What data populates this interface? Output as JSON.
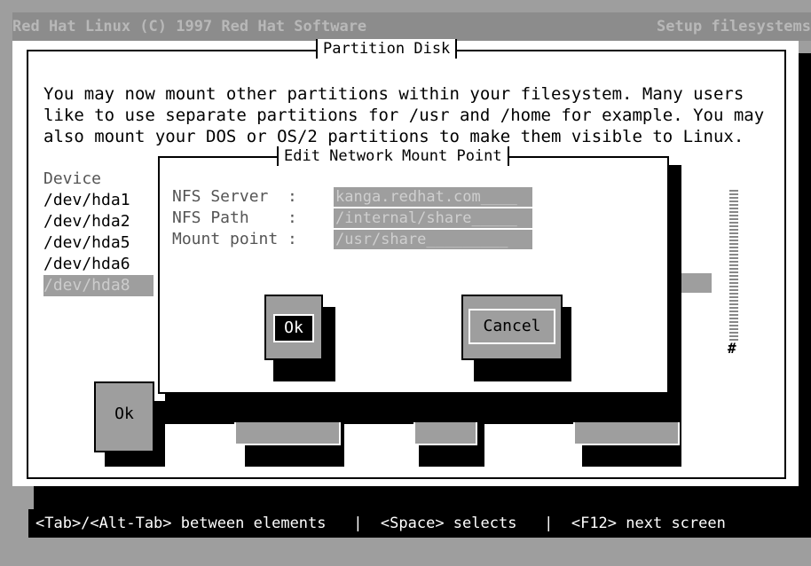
{
  "topbar": {
    "left": "Red Hat Linux (C) 1997 Red Hat Software",
    "right": "Setup filesystems"
  },
  "partition_disk": {
    "title": "Partition Disk",
    "paragraph": "You may now mount other partitions within your filesystem. Many users\nlike to use separate partitions for /usr and /home for example. You may\nalso mount your DOS or OS/2 partitions to make them visible to Linux.",
    "device_header": "Device",
    "devices": [
      "/dev/hda1",
      "/dev/hda2",
      "/dev/hda5",
      "/dev/hda6",
      "/dev/hda8"
    ],
    "ok_label": "Ok",
    "scroll_marker": "#"
  },
  "dialog": {
    "title": "Edit Network Mount Point",
    "fields": [
      {
        "label": "NFS Server  :",
        "value": "kanga.redhat.com____"
      },
      {
        "label": "NFS Path    :",
        "value": "/internal/share_____"
      },
      {
        "label": "Mount point :",
        "value": "/usr/share_________"
      }
    ],
    "ok_label": "Ok",
    "cancel_label": "Cancel"
  },
  "statusbar": {
    "text": "<Tab>/<Alt-Tab> between elements   |  <Space> selects   |  <F12> next screen"
  }
}
